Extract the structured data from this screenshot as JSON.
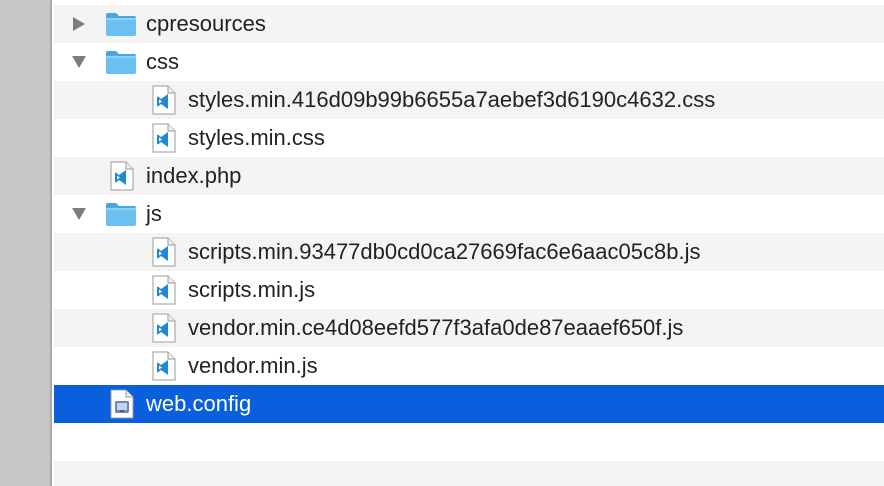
{
  "colors": {
    "selection": "#0a5fdc",
    "folder": "#5cb5ea",
    "vscode_blue": "#1f8ad2"
  },
  "rows": [
    {
      "name": "cpresources",
      "kind": "folder",
      "expanded": false,
      "selected": false,
      "icon": "folder-icon"
    },
    {
      "name": "css",
      "kind": "folder",
      "expanded": true,
      "selected": false,
      "icon": "folder-icon"
    },
    {
      "name": "styles.min.416d09b99b6655a7aebef3d6190c4632.css",
      "kind": "file",
      "selected": false,
      "icon": "vscode-file-icon"
    },
    {
      "name": "styles.min.css",
      "kind": "file",
      "selected": false,
      "icon": "vscode-file-icon"
    },
    {
      "name": "index.php",
      "kind": "file",
      "selected": false,
      "icon": "vscode-file-icon"
    },
    {
      "name": "js",
      "kind": "folder",
      "expanded": true,
      "selected": false,
      "icon": "folder-icon"
    },
    {
      "name": "scripts.min.93477db0cd0ca27669fac6e6aac05c8b.js",
      "kind": "file",
      "selected": false,
      "icon": "vscode-file-icon"
    },
    {
      "name": "scripts.min.js",
      "kind": "file",
      "selected": false,
      "icon": "vscode-file-icon"
    },
    {
      "name": "vendor.min.ce4d08eefd577f3afa0de87eaaef650f.js",
      "kind": "file",
      "selected": false,
      "icon": "vscode-file-icon"
    },
    {
      "name": "vendor.min.js",
      "kind": "file",
      "selected": false,
      "icon": "vscode-file-icon"
    },
    {
      "name": "web.config",
      "kind": "file",
      "selected": true,
      "icon": "config-file-icon"
    }
  ]
}
